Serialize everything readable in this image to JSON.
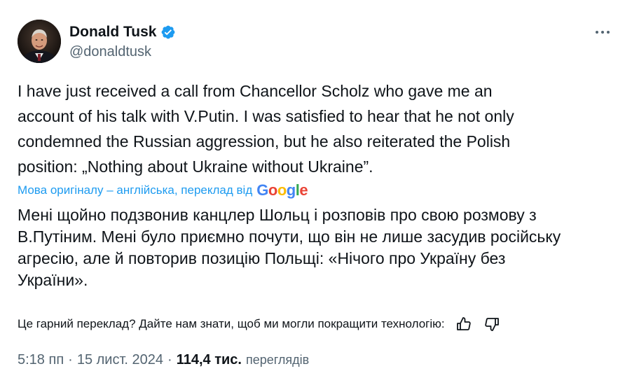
{
  "author": {
    "display_name": "Donald Tusk",
    "handle": "@donaldtusk",
    "verified": true
  },
  "tweet": {
    "text": "I have just received a call from Chancellor Scholz who gave me an\naccount of his talk with V.Putin. I was satisfied to hear that he not only\ncondemned the Russian aggression, but he also reiterated the Polish\nposition: „Nothing about Ukraine without Ukraine”."
  },
  "translation": {
    "meta_label": "Мова оригіналу – англійська, переклад від",
    "provider": "Google",
    "text": "Мені щойно подзвонив канцлер Шольц і розповів про свою розмову з\nВ.Путіним. Мені було приємно почути, що він не лише засудив російську\nагресію, але й повторив позицію Польщі: «Нічого про Україну без\nУкраїни».",
    "feedback_prompt": "Це гарний переклад? Дайте нам знати, щоб ми могли покращити технологію:"
  },
  "meta": {
    "time": "5:18 пп",
    "date": "15 лист. 2024",
    "views_count": "114,4 тис.",
    "views_label": "переглядів",
    "separator": "·"
  },
  "icons": {
    "verified": "verified-badge-icon",
    "more": "more-options-icon",
    "thumb_up": "thumbs-up-icon",
    "thumb_down": "thumbs-down-icon"
  },
  "colors": {
    "accent": "#1d9bf0",
    "text": "#0f1419",
    "secondary": "#536471"
  }
}
